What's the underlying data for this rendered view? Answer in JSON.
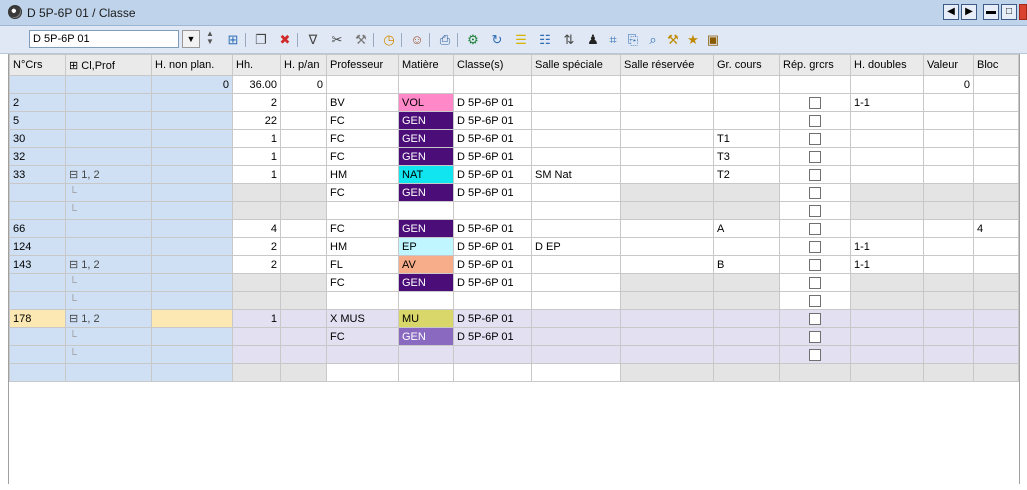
{
  "window": {
    "title": "D 5P-6P 01 / Classe"
  },
  "toolbar": {
    "combo_value": "D 5P-6P 01",
    "icons": [
      "grid-icon",
      "new-icon",
      "delete-icon",
      "filter-icon",
      "link-icon",
      "tools-icon",
      "clock-icon",
      "people-icon",
      "print-icon",
      "gear-check-icon",
      "refresh-icon",
      "list-icon",
      "report-icon",
      "sort-icon",
      "teacher-icon",
      "calc-icon",
      "copy-icon",
      "search-icon",
      "settings-icon",
      "magic-icon",
      "windows-icon"
    ]
  },
  "columns": [
    "N°Crs",
    "⊞ Cl,Prof",
    "H. non plan.",
    "Hh.",
    "H. p/an",
    "Professeur",
    "Matière",
    "Classe(s)",
    "Salle spéciale",
    "Salle réservée",
    "Gr. cours",
    "Rép. grcrs",
    "H. doubles",
    "Valeur",
    "Bloc"
  ],
  "totals": {
    "hnp": "0",
    "hh": "36.00",
    "hpan": "0",
    "valeur": "0"
  },
  "rows": [
    {
      "crs": "2",
      "cl": "",
      "hh": "2",
      "prof": "BV",
      "mat": "VOL",
      "matColor": "#ff88c8",
      "matText": "#000",
      "cls": "D 5P-6P 01",
      "ss": "",
      "sr": "",
      "gc": "",
      "hd": "1-1",
      "bloc": "",
      "type": "main"
    },
    {
      "crs": "5",
      "cl": "",
      "hh": "22",
      "prof": "FC",
      "mat": "GEN",
      "matColor": "#4b0e78",
      "matText": "#fff",
      "cls": "D 5P-6P 01",
      "ss": "",
      "sr": "",
      "gc": "",
      "hd": "",
      "bloc": "",
      "type": "main"
    },
    {
      "crs": "30",
      "cl": "",
      "hh": "1",
      "prof": "FC",
      "mat": "GEN",
      "matColor": "#4b0e78",
      "matText": "#fff",
      "cls": "D 5P-6P 01",
      "ss": "",
      "sr": "",
      "gc": "T1",
      "hd": "",
      "bloc": "",
      "type": "main"
    },
    {
      "crs": "32",
      "cl": "",
      "hh": "1",
      "prof": "FC",
      "mat": "GEN",
      "matColor": "#4b0e78",
      "matText": "#fff",
      "cls": "D 5P-6P 01",
      "ss": "",
      "sr": "",
      "gc": "T3",
      "hd": "",
      "bloc": "",
      "type": "main"
    },
    {
      "crs": "33",
      "cl": "⊟ 1, 2",
      "hh": "1",
      "prof": "HM",
      "mat": "NAT",
      "matColor": "#11e6f0",
      "matText": "#000",
      "cls": "D 5P-6P 01",
      "ss": "SM Nat",
      "sr": "",
      "gc": "T2",
      "hd": "",
      "bloc": "",
      "type": "main"
    },
    {
      "crs": "",
      "cl": "",
      "hh": "",
      "prof": "FC",
      "mat": "GEN",
      "matColor": "#4b0e78",
      "matText": "#fff",
      "cls": "D 5P-6P 01",
      "ss": "",
      "sr": "",
      "gc": "",
      "hd": "",
      "bloc": "",
      "type": "sub"
    },
    {
      "crs": "",
      "cl": "",
      "hh": "",
      "prof": "",
      "mat": "",
      "matColor": "",
      "matText": "",
      "cls": "",
      "ss": "",
      "sr": "",
      "gc": "",
      "hd": "",
      "bloc": "",
      "type": "sub"
    },
    {
      "crs": "66",
      "cl": "",
      "hh": "4",
      "prof": "FC",
      "mat": "GEN",
      "matColor": "#4b0e78",
      "matText": "#fff",
      "cls": "D 5P-6P 01",
      "ss": "",
      "sr": "",
      "gc": "A",
      "hd": "",
      "bloc": "4",
      "type": "main"
    },
    {
      "crs": "124",
      "cl": "",
      "hh": "2",
      "prof": "HM",
      "mat": "EP",
      "matColor": "#bff6ff",
      "matText": "#000",
      "cls": "D 5P-6P 01",
      "ss": "D EP",
      "sr": "",
      "gc": "",
      "hd": "1-1",
      "bloc": "",
      "type": "main"
    },
    {
      "crs": "143",
      "cl": "⊟ 1, 2",
      "hh": "2",
      "prof": "FL",
      "mat": "AV",
      "matColor": "#f7ac8a",
      "matText": "#000",
      "cls": "D 5P-6P 01",
      "ss": "",
      "sr": "",
      "gc": "B",
      "hd": "1-1",
      "bloc": "",
      "type": "main"
    },
    {
      "crs": "",
      "cl": "",
      "hh": "",
      "prof": "FC",
      "mat": "GEN",
      "matColor": "#4b0e78",
      "matText": "#fff",
      "cls": "D 5P-6P 01",
      "ss": "",
      "sr": "",
      "gc": "",
      "hd": "",
      "bloc": "",
      "type": "sub"
    },
    {
      "crs": "",
      "cl": "",
      "hh": "",
      "prof": "",
      "mat": "",
      "matColor": "",
      "matText": "",
      "cls": "",
      "ss": "",
      "sr": "",
      "gc": "",
      "hd": "",
      "bloc": "",
      "type": "sub"
    },
    {
      "crs": "178",
      "cl": "⊟ 1, 2",
      "hh": "1",
      "prof": "X MUS",
      "mat": "MU",
      "matColor": "#d9d66a",
      "matText": "#000",
      "cls": "D 5P-6P 01",
      "ss": "",
      "sr": "",
      "gc": "",
      "hd": "",
      "bloc": "",
      "type": "sel"
    },
    {
      "crs": "",
      "cl": "",
      "hh": "",
      "prof": "FC",
      "mat": "GEN",
      "matColor": "#8a6ac0",
      "matText": "#fff",
      "cls": "D 5P-6P 01",
      "ss": "",
      "sr": "",
      "gc": "",
      "hd": "",
      "bloc": "",
      "type": "selsub"
    },
    {
      "crs": "",
      "cl": "",
      "hh": "",
      "prof": "",
      "mat": "",
      "matColor": "",
      "matText": "",
      "cls": "",
      "ss": "",
      "sr": "",
      "gc": "",
      "hd": "",
      "bloc": "",
      "type": "selsub"
    },
    {
      "crs": "",
      "cl": "",
      "hh": "",
      "prof": "",
      "mat": "",
      "matColor": "",
      "matText": "",
      "cls": "",
      "ss": "",
      "sr": "",
      "gc": "",
      "hd": "",
      "bloc": "",
      "type": "empty"
    }
  ]
}
